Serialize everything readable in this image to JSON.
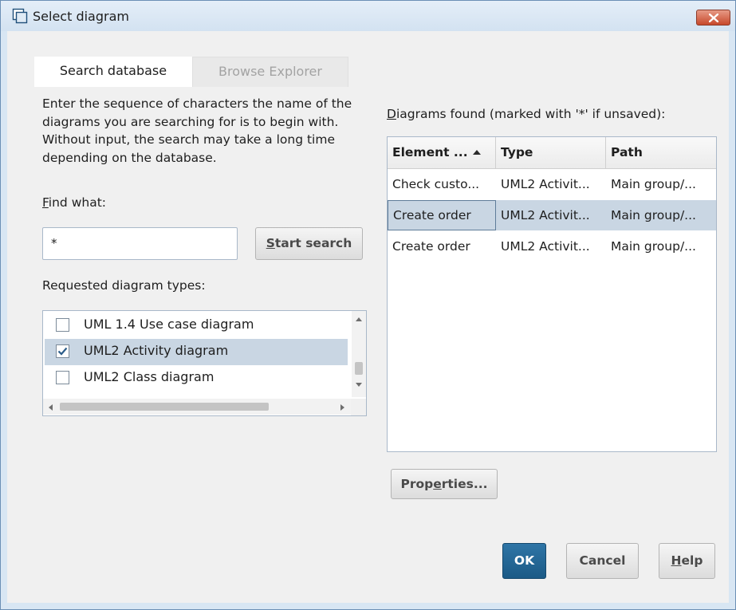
{
  "window": {
    "title": "Select diagram"
  },
  "tabs": [
    {
      "label": "Search database",
      "active": true
    },
    {
      "label": "Browse Explorer",
      "active": false
    }
  ],
  "search": {
    "description": "Enter the sequence of characters the name of the diagrams you are searching for is to begin with. Without input, the search may take a long time depending on the database.",
    "find_label_key": "F",
    "find_label_rest": "ind what:",
    "find_value": "*",
    "start_button_key": "S",
    "start_button_rest": "tart search",
    "types_label": "Requested diagram types:"
  },
  "diagram_types": [
    {
      "label": "UML 1.4 Use case diagram",
      "checked": false,
      "selected": false
    },
    {
      "label": "UML2 Activity diagram",
      "checked": true,
      "selected": true
    },
    {
      "label": "UML2 Class diagram",
      "checked": false,
      "selected": false
    }
  ],
  "results": {
    "label_key": "D",
    "label_rest": "iagrams found (marked with '*' if unsaved):",
    "columns": [
      {
        "label": "Element ...",
        "sort": "ascending"
      },
      {
        "label": "Type"
      },
      {
        "label": "Path"
      }
    ],
    "rows": [
      {
        "element": "Check custo...",
        "type": "UML2 Activit...",
        "path": "Main group/...",
        "selected": false
      },
      {
        "element": "Create order",
        "type": "UML2 Activit...",
        "path": "Main group/...",
        "selected": true
      },
      {
        "element": "Create order",
        "type": "UML2 Activit...",
        "path": "Main group/...",
        "selected": false
      }
    ],
    "properties_pre": "Prop",
    "properties_key": "e",
    "properties_post": "rties..."
  },
  "footer": {
    "ok_label": "OK",
    "cancel_label": "Cancel",
    "help_key": "H",
    "help_rest": "elp"
  },
  "colors": {
    "accent_blue": "#1f5f8b",
    "selection": "#c9d6e3",
    "close_red": "#c7492c"
  },
  "icons": {
    "window": "diagram-window-icon",
    "close": "close-icon",
    "sort": "sort-ascending-icon",
    "check": "checkmark-icon"
  }
}
